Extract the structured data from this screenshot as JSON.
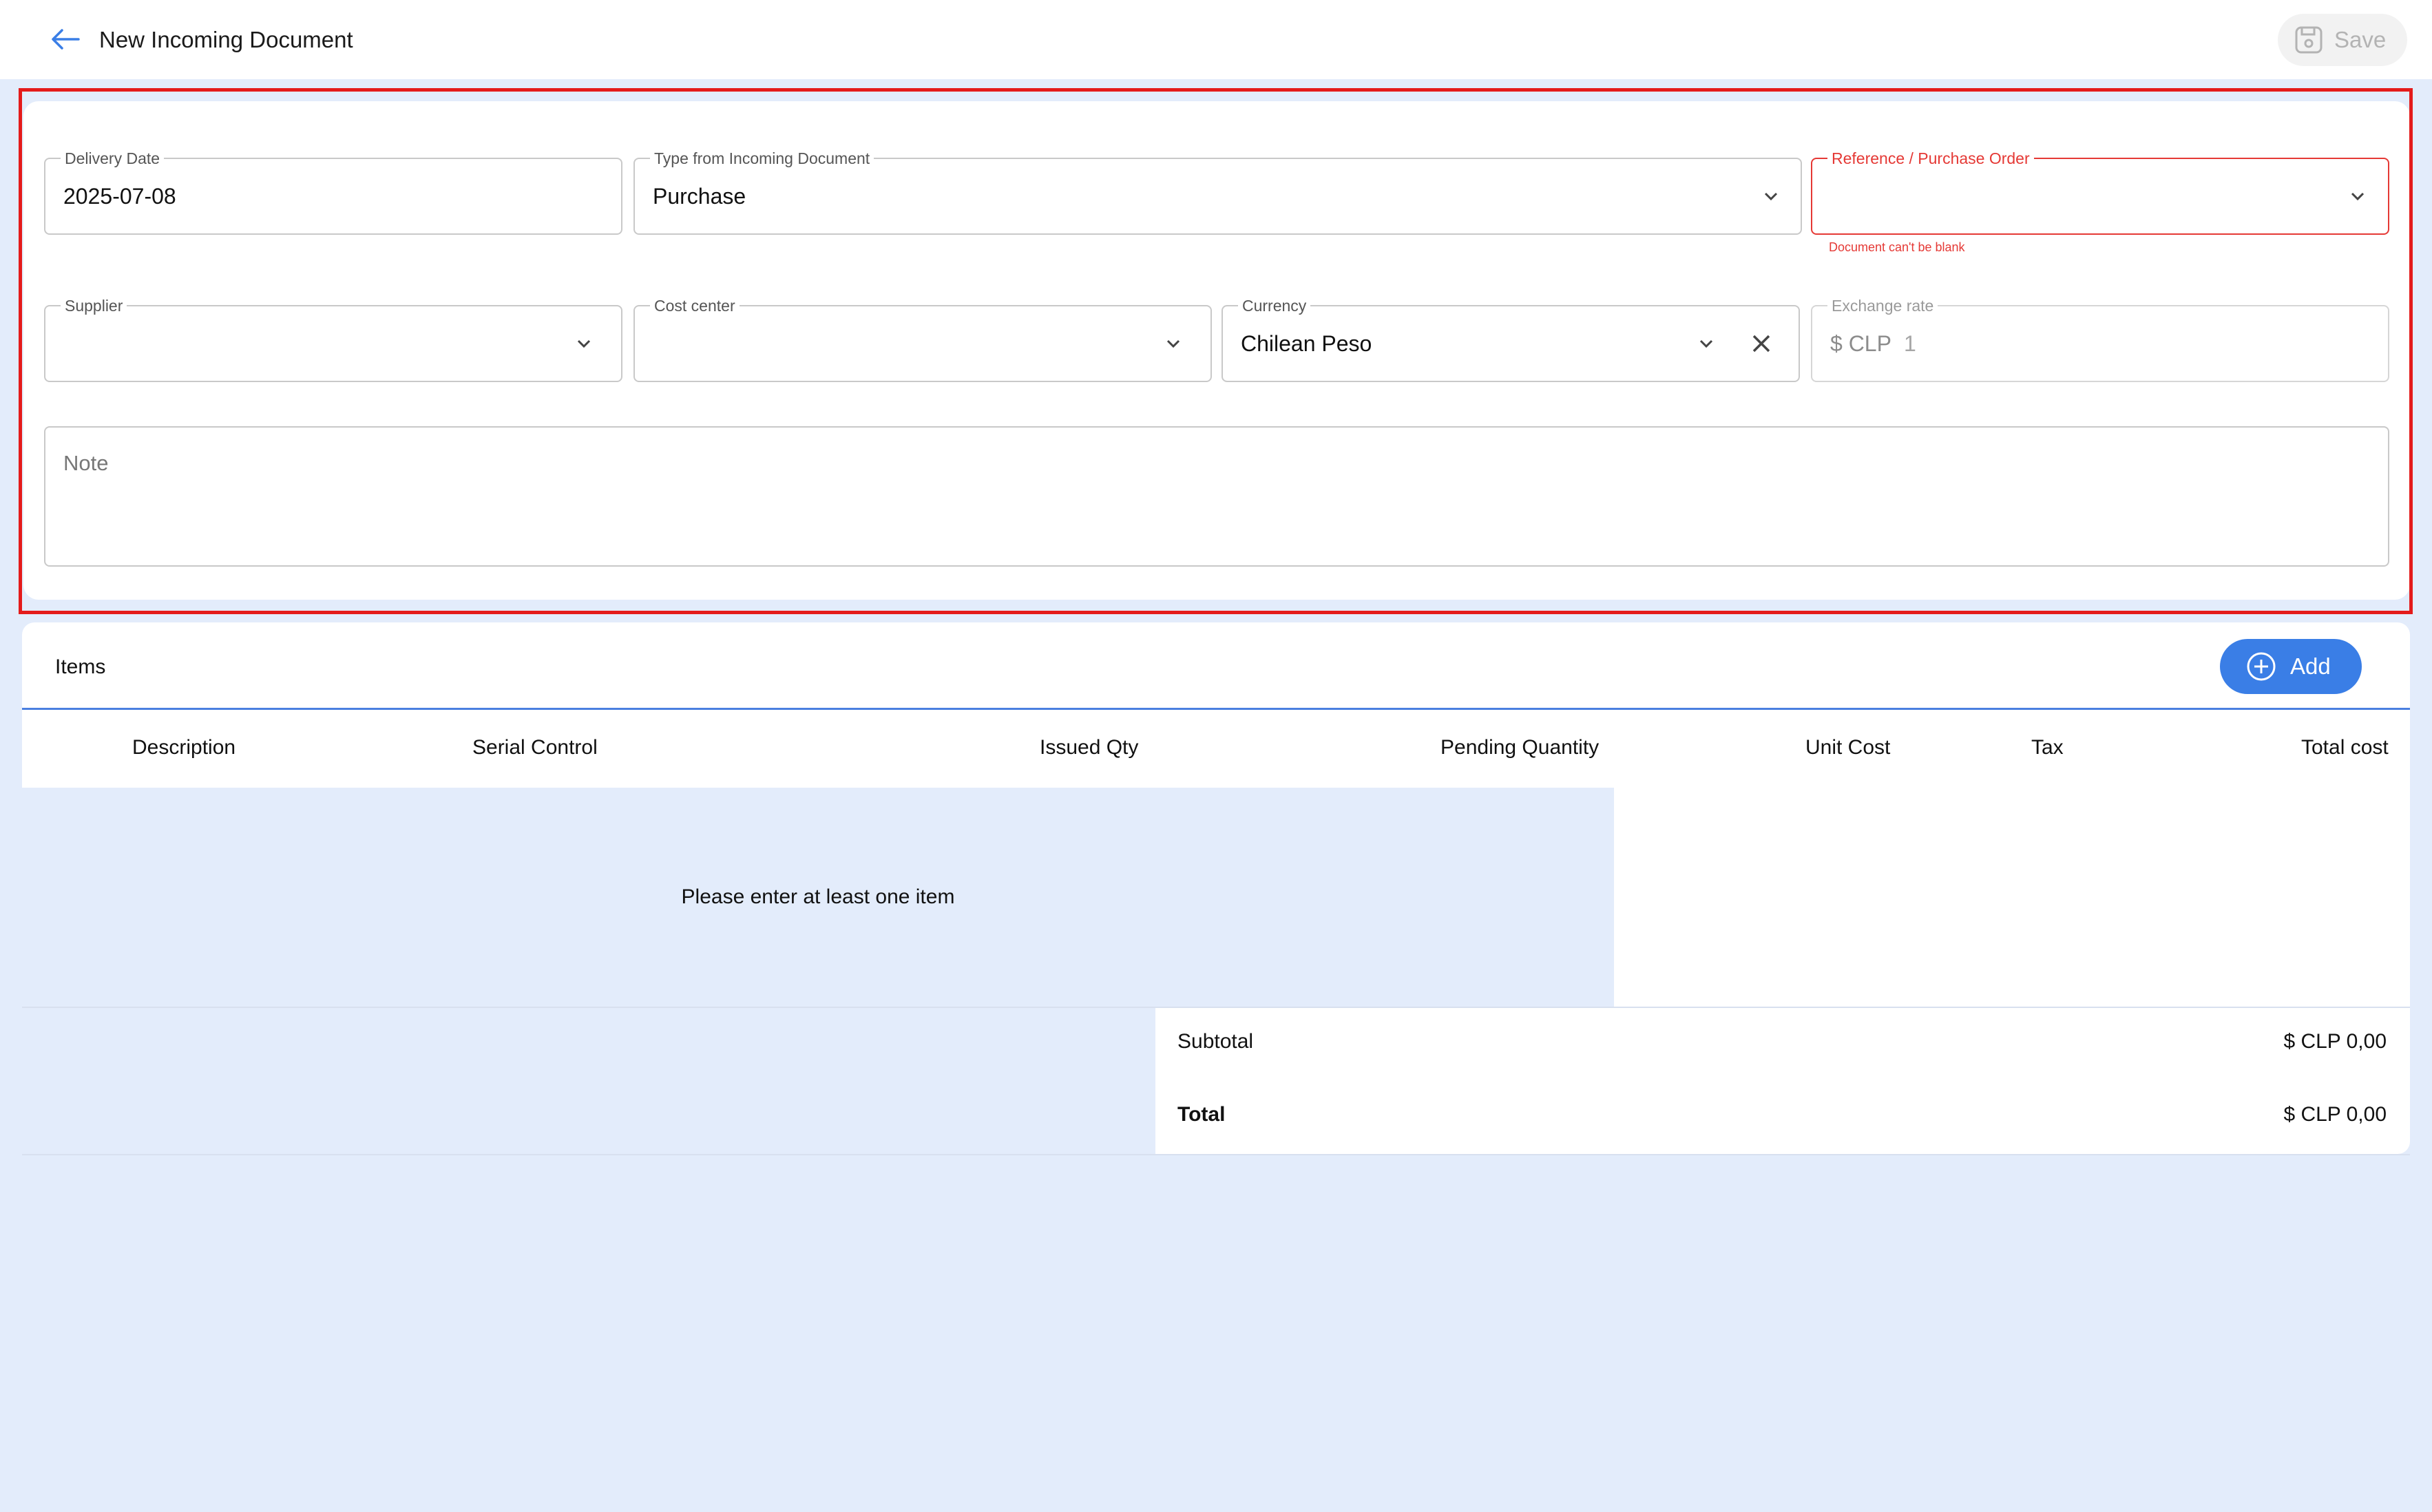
{
  "header": {
    "title": "New Incoming Document",
    "save_label": "Save"
  },
  "form": {
    "delivery_date": {
      "label": "Delivery Date",
      "value": "2025-07-08"
    },
    "type": {
      "label": "Type from Incoming Document",
      "value": "Purchase"
    },
    "reference": {
      "label": "Reference / Purchase Order",
      "value": "",
      "error": "Document can't be blank"
    },
    "supplier": {
      "label": "Supplier",
      "value": ""
    },
    "cost_center": {
      "label": "Cost center",
      "value": ""
    },
    "currency": {
      "label": "Currency",
      "value": "Chilean Peso"
    },
    "exchange_rate": {
      "label": "Exchange rate",
      "prefix": "$ CLP",
      "value": "1"
    },
    "note": {
      "placeholder": "Note"
    }
  },
  "items": {
    "title": "Items",
    "add_label": "Add",
    "columns": [
      "Description",
      "Serial Control",
      "Issued Qty",
      "Pending Quantity",
      "Unit Cost",
      "Tax",
      "Total cost"
    ],
    "empty_message": "Please enter at least one item"
  },
  "totals": {
    "subtotal_label": "Subtotal",
    "subtotal_value": "$ CLP 0,00",
    "total_label": "Total",
    "total_value": "$ CLP 0,00"
  },
  "colors": {
    "accent": "#3a7ee6",
    "error": "#e53935",
    "background": "#e3ecfb",
    "highlight": "#e41b1b"
  }
}
